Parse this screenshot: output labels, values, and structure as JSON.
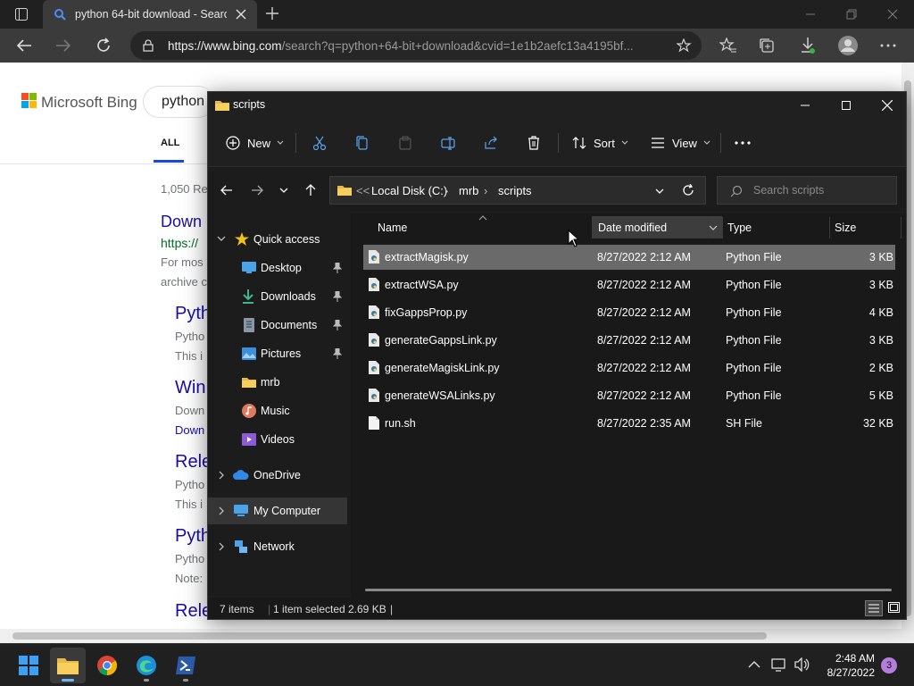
{
  "browser": {
    "tab_title": "python 64-bit download - Search",
    "url_host": "https://www.bing.com",
    "url_rest": "/search?q=python+64-bit+download&cvid=1e1b2aefc13a4195bf...",
    "bing": {
      "logo_text": "Microsoft Bing",
      "query": "python",
      "tab_all": "ALL",
      "results_count": "1,050 Re",
      "results": [
        {
          "title": "Down",
          "url": "https://",
          "snip1": "For mos",
          "snip2": "archive c"
        },
        {
          "title": "Pyth",
          "snip1": "Pytho",
          "snip2": "This i"
        },
        {
          "title": "Win",
          "snip1": "Down",
          "snip2": "Down"
        },
        {
          "title": "Rele",
          "snip1": "Pytho",
          "snip2": "This i"
        },
        {
          "title": "Pyth",
          "snip1": "Pytho",
          "snip2": "Note:"
        },
        {
          "title": "Rele"
        }
      ]
    }
  },
  "explorer": {
    "title": "scripts",
    "toolbar": {
      "new_label": "New",
      "sort_label": "Sort",
      "view_label": "View"
    },
    "breadcrumb": {
      "root": "Local Disk (C:)",
      "mid": "mrb",
      "leaf": "scripts"
    },
    "search_placeholder": "Search scripts",
    "nav": {
      "quick_access": "Quick access",
      "items": [
        {
          "label": "Desktop",
          "pinned": true
        },
        {
          "label": "Downloads",
          "pinned": true
        },
        {
          "label": "Documents",
          "pinned": true
        },
        {
          "label": "Pictures",
          "pinned": true
        },
        {
          "label": "mrb",
          "pinned": false
        },
        {
          "label": "Music",
          "pinned": false
        },
        {
          "label": "Videos",
          "pinned": false
        }
      ],
      "onedrive": "OneDrive",
      "my_computer": "My Computer",
      "network": "Network"
    },
    "columns": {
      "name": "Name",
      "date": "Date modified",
      "type": "Type",
      "size": "Size"
    },
    "files": [
      {
        "name": "extractMagisk.py",
        "date": "8/27/2022 2:12 AM",
        "type": "Python File",
        "size": "3 KB",
        "selected": true
      },
      {
        "name": "extractWSA.py",
        "date": "8/27/2022 2:12 AM",
        "type": "Python File",
        "size": "3 KB"
      },
      {
        "name": "fixGappsProp.py",
        "date": "8/27/2022 2:12 AM",
        "type": "Python File",
        "size": "4 KB"
      },
      {
        "name": "generateGappsLink.py",
        "date": "8/27/2022 2:12 AM",
        "type": "Python File",
        "size": "3 KB"
      },
      {
        "name": "generateMagiskLink.py",
        "date": "8/27/2022 2:12 AM",
        "type": "Python File",
        "size": "2 KB"
      },
      {
        "name": "generateWSALinks.py",
        "date": "8/27/2022 2:12 AM",
        "type": "Python File",
        "size": "5 KB"
      },
      {
        "name": "run.sh",
        "date": "8/27/2022 2:35 AM",
        "type": "SH File",
        "size": "32 KB"
      }
    ],
    "status": {
      "count": "7 items",
      "selection": "1 item selected",
      "size": "2.69 KB"
    }
  },
  "taskbar": {
    "time": "2:48 AM",
    "date": "8/27/2022",
    "notifications": "3"
  }
}
